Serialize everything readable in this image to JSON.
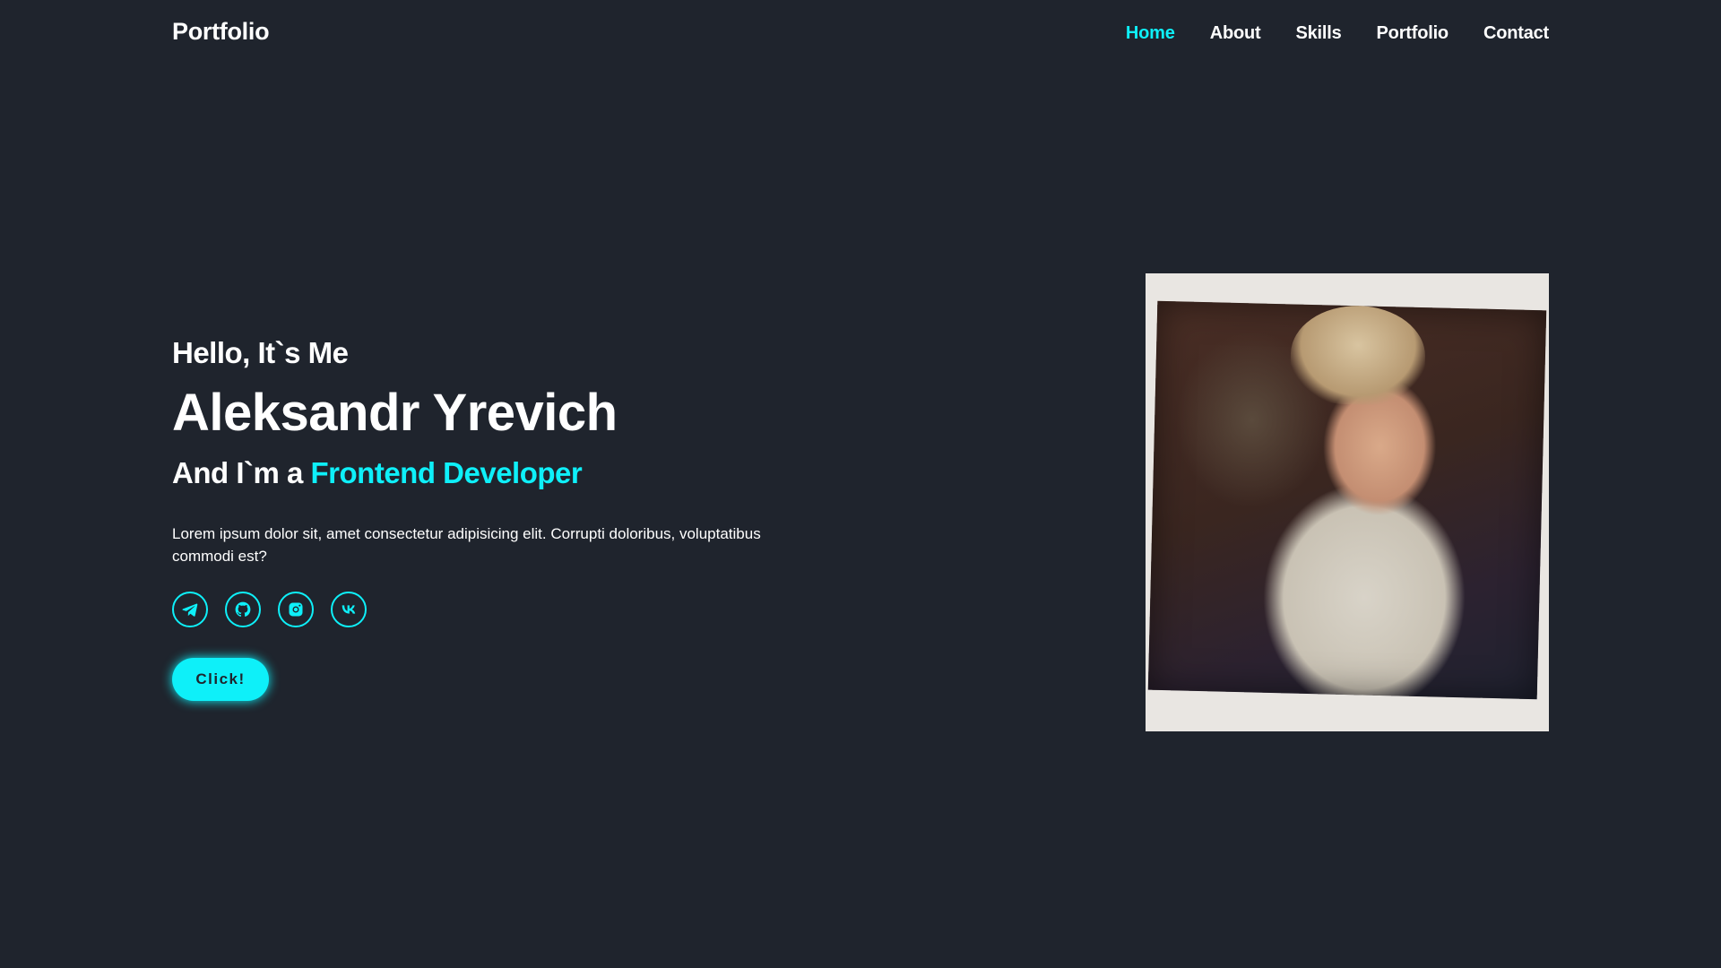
{
  "header": {
    "logo": "Portfolio",
    "nav": [
      {
        "label": "Home",
        "active": true
      },
      {
        "label": "About",
        "active": false
      },
      {
        "label": "Skills",
        "active": false
      },
      {
        "label": "Portfolio",
        "active": false
      },
      {
        "label": "Contact",
        "active": false
      }
    ]
  },
  "home": {
    "greeting": "Hello, It`s Me",
    "name": "Aleksandr Yrevich",
    "role_prefix": "And I`m a ",
    "role_highlight": "Frontend Developer",
    "description": "Lorem ipsum dolor sit, amet consectetur adipisicing elit. Corrupti doloribus, voluptatibus commodi est?",
    "socials": [
      "telegram-icon",
      "github-icon",
      "instagram-icon",
      "vk-icon"
    ],
    "button_label": "Click!"
  },
  "colors": {
    "background": "#1f242d",
    "accent": "#0ef0f9",
    "text": "#ffffff"
  }
}
